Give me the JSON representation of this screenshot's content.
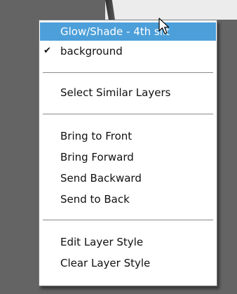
{
  "menu": {
    "items": [
      {
        "label": "Glow/Shade - 4th slit",
        "checked": false,
        "highlighted": true
      },
      {
        "label": "background",
        "checked": true,
        "highlighted": false
      },
      {
        "label": "Select Similar Layers",
        "checked": false,
        "highlighted": false
      },
      {
        "label": "Bring to Front",
        "checked": false,
        "highlighted": false
      },
      {
        "label": "Bring Forward",
        "checked": false,
        "highlighted": false
      },
      {
        "label": "Send Backward",
        "checked": false,
        "highlighted": false
      },
      {
        "label": "Send to Back",
        "checked": false,
        "highlighted": false
      },
      {
        "label": "Edit Layer Style",
        "checked": false,
        "highlighted": false
      },
      {
        "label": "Clear Layer Style",
        "checked": false,
        "highlighted": false
      }
    ],
    "check_glyph": "✔"
  },
  "cursor": {
    "icon": "mouse-pointer-arrow"
  },
  "colors": {
    "highlight": "#4c9fd9",
    "menu_bg": "#ffffff",
    "separator": "#8a8a8a"
  }
}
